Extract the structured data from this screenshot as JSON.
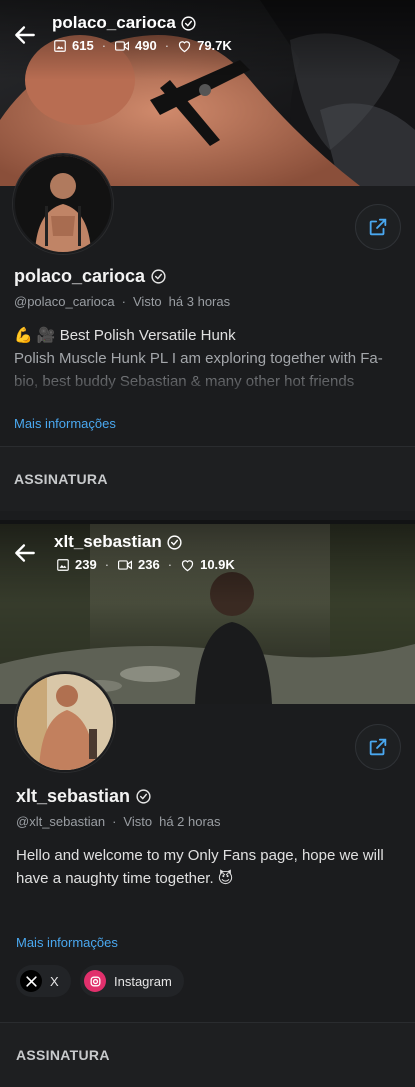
{
  "profiles": [
    {
      "display_name": "polaco_carioca",
      "handle": "@polaco_carioca",
      "seen_label": "Visto",
      "seen_time": "há 3 horas",
      "stats": {
        "photos": "615",
        "videos": "490",
        "likes": "79.7K"
      },
      "bio_emoji": "💪 🎥",
      "bio_title": "Best Polish Versatile Hunk",
      "bio_body": "Polish Muscle Hunk PL I am exploring together with Fa-bio, best buddy Sebastian & many other hot friends",
      "more_label": "Mais informações",
      "section_title": "ASSINATURA"
    },
    {
      "display_name": "xlt_sebastian",
      "handle": "@xlt_sebastian",
      "seen_label": "Visto",
      "seen_time": "há 2 horas",
      "stats": {
        "photos": "239",
        "videos": "236",
        "likes": "10.9K"
      },
      "bio_text": "Hello and welcome to my Only Fans page, hope we will have a naughty time together. 😈",
      "more_label": "Mais informações",
      "socials": [
        {
          "label": "X",
          "icon": "x-icon"
        },
        {
          "label": "Instagram",
          "icon": "instagram-icon"
        }
      ],
      "section_title": "ASSINATURA"
    }
  ],
  "colors": {
    "link": "#4aa8f0",
    "instagram": "#e1306c",
    "background": "#1b1c1e"
  }
}
